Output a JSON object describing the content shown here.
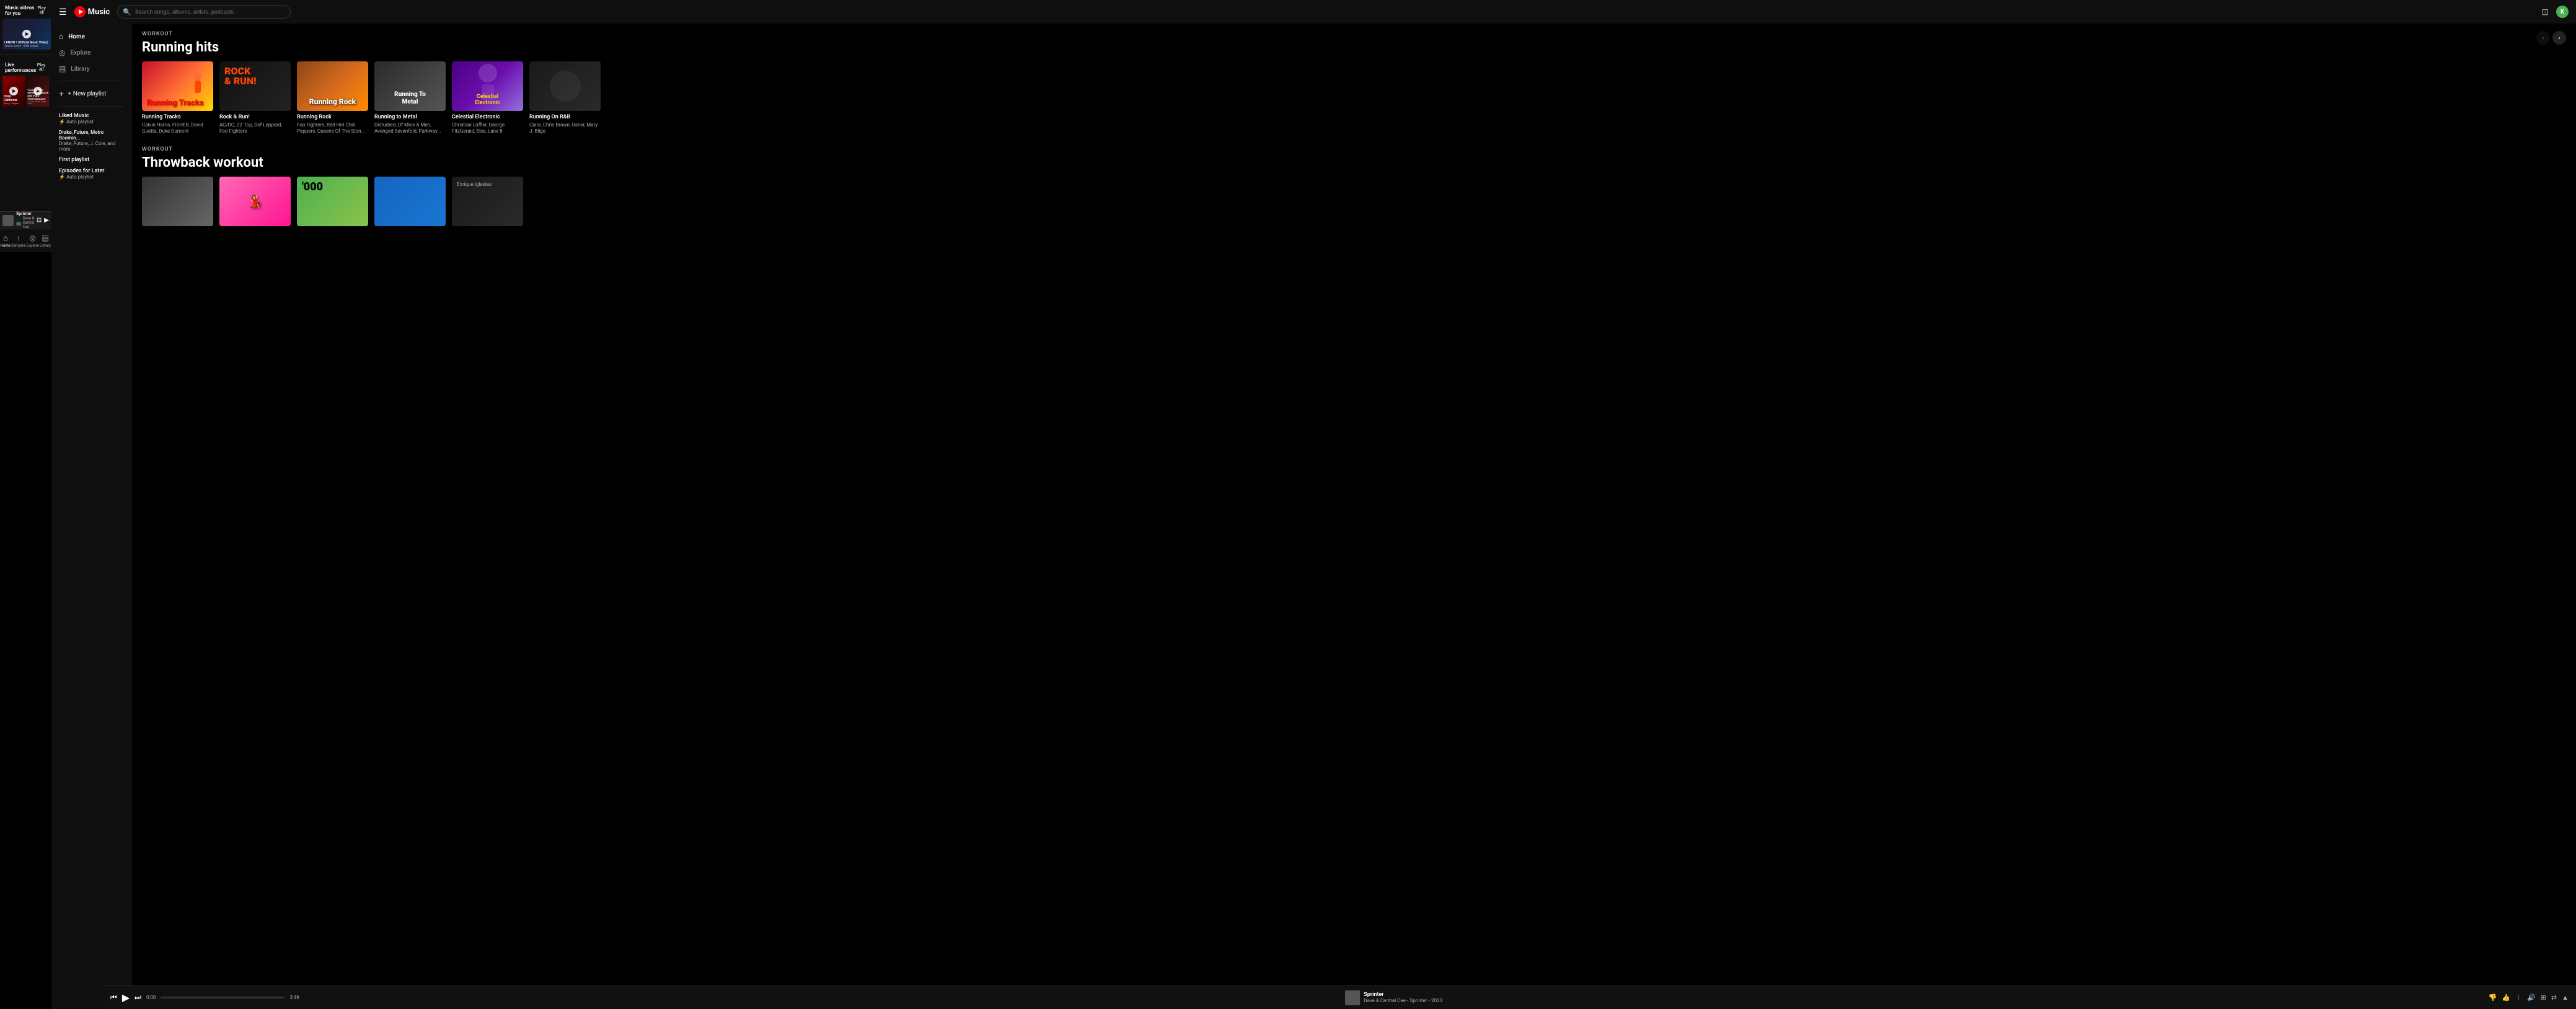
{
  "app": {
    "title": "Music",
    "logo_letter": "K"
  },
  "header": {
    "search_placeholder": "Search songs, albums, artists, podcasts",
    "hamburger_label": "☰",
    "cast_icon": "⊡"
  },
  "sidebar": {
    "nav_items": [
      {
        "id": "home",
        "label": "Home",
        "icon": "⌂",
        "active": true
      },
      {
        "id": "explore",
        "label": "Explore",
        "icon": "◎",
        "active": false
      },
      {
        "id": "library",
        "label": "Library",
        "icon": "▤",
        "active": false
      }
    ],
    "new_playlist_label": "+ New playlist",
    "playlists": [
      {
        "id": "liked-music",
        "name": "Liked Music",
        "sub": "Auto playlist",
        "has_lightning": true
      },
      {
        "id": "drake-future",
        "name": "Drake, Future, Metro Boomin...",
        "sub": "Drake, Future, J. Cole, and more",
        "has_lightning": false
      },
      {
        "id": "first-playlist",
        "name": "First playlist",
        "sub": "",
        "has_lightning": false
      },
      {
        "id": "episodes-later",
        "name": "Episodes for Later",
        "sub": "Auto playlist",
        "has_lightning": true
      }
    ]
  },
  "workout_section": {
    "label": "WORKOUT",
    "title": "Running hits",
    "cards": [
      {
        "id": "running-tracks",
        "title": "Running Tracks",
        "artists": "Calvin Harris, FISHER, David Guetta, Duke Dumont",
        "bg_type": "running-tracks"
      },
      {
        "id": "rock-run",
        "title": "Rock & Run!",
        "artists": "AC/DC, ZZ Top, Def Leppard, Foo Fighters",
        "bg_type": "rock-run"
      },
      {
        "id": "running-rock",
        "title": "Running Rock",
        "artists": "Foo Fighters, Red Hot Chili Peppers, Queens Of The Ston...",
        "bg_type": "running-rock"
      },
      {
        "id": "running-metal",
        "title": "Running to Metal",
        "artists": "Disturbed, Of Mice & Men, Avenged Sevenfold, Parkway...",
        "bg_type": "running-metal"
      },
      {
        "id": "celestial",
        "title": "Celestial Electronic",
        "artists": "Christian Löffler, George FitzGerald, Else, Lane 8",
        "bg_type": "celestial"
      },
      {
        "id": "rnb",
        "title": "Running On R&B",
        "artists": "Ciara, Chris Brown, Usher, Mary J. Blige",
        "bg_type": "rnb"
      }
    ]
  },
  "throwback_section": {
    "label": "WORKOUT",
    "title": "Throwback workout"
  },
  "player": {
    "title": "Sprinter",
    "artist": "Dave & Central Cee",
    "album": "Sprinter",
    "year": "2023",
    "time_current": "0:00",
    "time_total": "3:49",
    "progress_percent": 0
  },
  "mobile_left": {
    "section1_title": "Music videos for you",
    "section2_title": "Live performances",
    "play_all": "Play all",
    "video1_title": "I KNOW ? (Official Music Video)",
    "video1_sub": "Travis Scott • 39M views",
    "video1_sub2": "21 S",
    "video2_title": "Hotel California",
    "video2_sub": "Song • Eagles",
    "video3_title": "\"NOT LIKE US\" KENDRICK LAMAR DRE (FULL PERFORMANCE",
    "video3_sub": "DJ Haki Official • 323K views",
    "mini_title": "Sprinter",
    "mini_sub": "Dave & Central Cee",
    "bottom_nav": [
      {
        "label": "Home",
        "icon": "⌂",
        "active": true
      },
      {
        "label": "Samples",
        "icon": "↑",
        "active": false
      },
      {
        "label": "Explore",
        "icon": "◎",
        "active": false
      },
      {
        "label": "Library",
        "icon": "▤",
        "active": false
      }
    ]
  }
}
